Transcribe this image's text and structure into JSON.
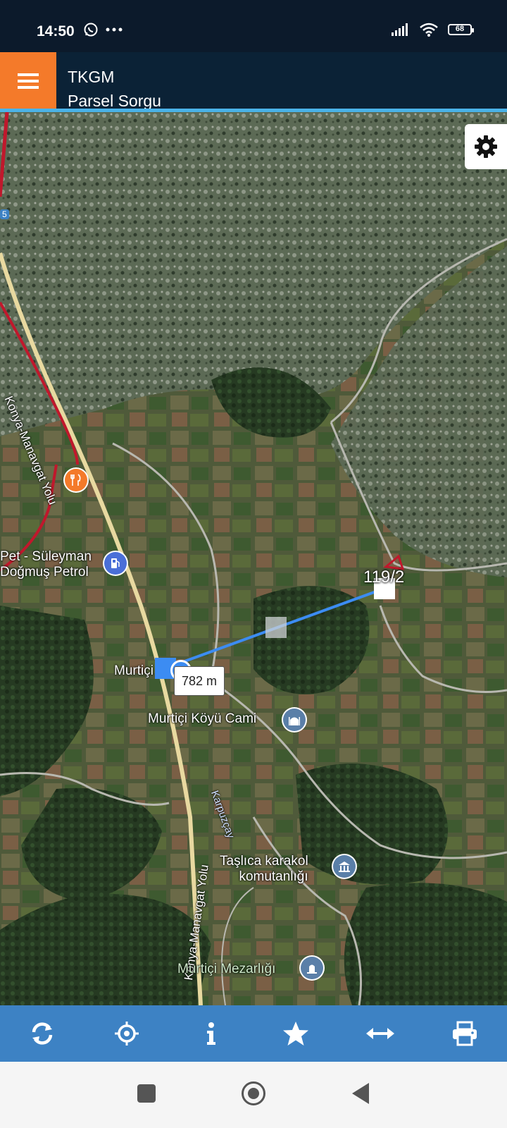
{
  "status_bar": {
    "time": "14:50",
    "battery": "68"
  },
  "header": {
    "title": "TKGM",
    "subtitle": "Parsel Sorgu"
  },
  "map": {
    "road_labels": [
      "Konya-Manavgat Yolu",
      "Konya-Manavgat Yolu",
      "Karpuzçay"
    ],
    "pois": [
      {
        "name": "Pet - Süleyman\nDoğmuş Petrol",
        "icon": "gas-station-icon"
      },
      {
        "name": "Murtiçi Köyü Cami",
        "icon": "mosque-icon"
      },
      {
        "name": "Taşlıca karakol\nkomutanlığı",
        "icon": "police-station-icon"
      },
      {
        "name": "Murtiçi Mezarlığı",
        "icon": "cemetery-icon"
      },
      {
        "name": "Murtiçi",
        "icon": "location-dot-icon"
      }
    ],
    "distance": "782 m",
    "parcel": "119/2",
    "restaurant_icon": "restaurant-icon",
    "road_number": "5"
  },
  "toolbar": {
    "buttons": [
      "refresh-icon",
      "locate-icon",
      "info-icon",
      "favorite-icon",
      "measure-icon",
      "print-icon"
    ]
  },
  "colors": {
    "accent": "#f47a2a",
    "header": "#0b2236",
    "toolbar": "#3d82c4",
    "measure_line": "#3c8cf2",
    "parcel_outline": "#c0182c"
  }
}
